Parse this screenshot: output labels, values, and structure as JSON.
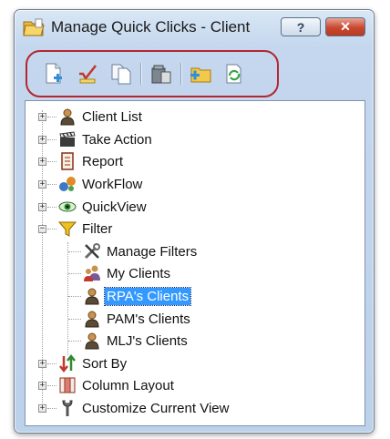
{
  "window": {
    "title": "Manage Quick Clicks - Client",
    "help_label": "?",
    "close_label": "✕"
  },
  "toolbar": {
    "buttons": [
      {
        "name": "new-icon"
      },
      {
        "name": "edit-icon"
      },
      {
        "name": "copy-icon"
      },
      {
        "name": "delete-icon"
      },
      {
        "name": "add-folder-icon"
      },
      {
        "name": "refresh-icon"
      }
    ],
    "highlight_color": "#b3262e"
  },
  "tree": {
    "nodes": [
      {
        "label": "Client List",
        "icon": "person-icon",
        "expander": "+"
      },
      {
        "label": "Take Action",
        "icon": "clapperboard-icon",
        "expander": "+"
      },
      {
        "label": "Report",
        "icon": "report-icon",
        "expander": "+"
      },
      {
        "label": "WorkFlow",
        "icon": "workflow-icon",
        "expander": "+"
      },
      {
        "label": "QuickView",
        "icon": "eye-icon",
        "expander": "+"
      },
      {
        "label": "Filter",
        "icon": "funnel-icon",
        "expander": "−"
      },
      {
        "label": "Manage Filters",
        "icon": "tools-icon"
      },
      {
        "label": "My Clients",
        "icon": "people-icon"
      },
      {
        "label": "RPA's Clients",
        "icon": "person-icon",
        "selected": true
      },
      {
        "label": "PAM's Clients",
        "icon": "person-icon"
      },
      {
        "label": "MLJ's Clients",
        "icon": "person-icon"
      },
      {
        "label": "Sort By",
        "icon": "sort-icon",
        "expander": "+"
      },
      {
        "label": "Column Layout",
        "icon": "columns-icon",
        "expander": "+"
      },
      {
        "label": "Customize Current View",
        "icon": "wrench-icon",
        "expander": "+"
      }
    ],
    "selection_color": "#3399ff"
  }
}
